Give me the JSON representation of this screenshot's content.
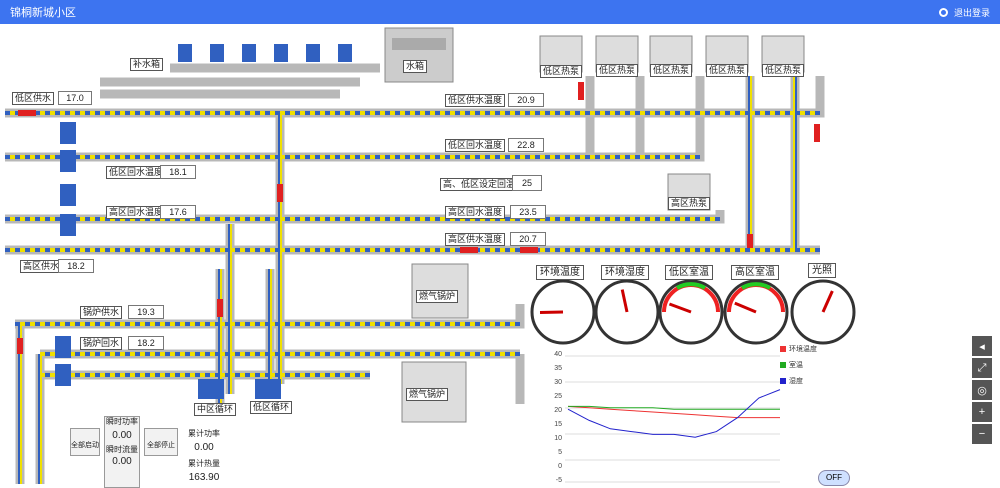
{
  "app": {
    "title": "锦桐新城小区",
    "logout_label": "退出登录"
  },
  "labels": {
    "tank": "补水箱",
    "storage": "水箱",
    "low_supply": "低区供水",
    "high_supply": "高区供水",
    "low_return_temp": "低区回水温度",
    "high_return_temp": "高区回水温度",
    "low_supply_temp": "低区供水温度",
    "low_return_label": "低区回水温度",
    "setpoint": "高、低区设定回温",
    "high_return": "高区回水温度",
    "high_supply_temp": "高区供水温度",
    "boiler_supply": "锅炉供水",
    "boiler_return": "锅炉回水",
    "mid_pump": "中区循环",
    "low_pump": "低区循环",
    "boiler1": "燃气锅炉",
    "boiler2": "燃气锅炉",
    "hp1": "低区热泵",
    "hp2": "低区热泵",
    "hp3": "低区热泵",
    "hp4": "低区热泵",
    "hp5": "低区热泵",
    "hp6": "高区热泵"
  },
  "values": {
    "low_supply": "17.0",
    "high_supply": "18.2",
    "low_return_temp": "18.1",
    "high_return_temp": "17.6",
    "low_supply_temp": "20.9",
    "low_return_label": "22.8",
    "setpoint": "25",
    "high_return": "23.5",
    "high_supply_temp": "20.7",
    "boiler_supply": "19.3",
    "boiler_return": "18.2"
  },
  "gauges": [
    {
      "title": "环境温度",
      "value": 12
    },
    {
      "title": "环境湿度",
      "value": 45
    },
    {
      "title": "低区室温",
      "value": 21
    },
    {
      "title": "高区室温",
      "value": 22
    },
    {
      "title": "光照",
      "value": 60
    }
  ],
  "controls": {
    "power_label": "瞬时功率",
    "power_value": "0.00",
    "flow_label": "瞬时流量",
    "flow_value": "0.00",
    "total_label": "累计功率",
    "total_value": "0.00",
    "acc_label": "累计热量",
    "acc_value": "163.90",
    "open_label": "全部启动",
    "stop_label": "全部停止",
    "off_label": "OFF"
  },
  "chart_data": {
    "type": "line",
    "ylim": [
      -5,
      40
    ],
    "yticks": [
      -5,
      0,
      5,
      10,
      15,
      20,
      25,
      30,
      35,
      40
    ],
    "series": [
      {
        "name": "环境温度",
        "color": "#e33",
        "values": [
          22,
          21.5,
          21,
          20.5,
          20,
          19.5,
          19,
          18.5,
          18,
          18,
          18
        ]
      },
      {
        "name": "室温",
        "color": "#2a2",
        "values": [
          22,
          22,
          21.5,
          21.5,
          21.5,
          21,
          21,
          21,
          21,
          21,
          21
        ]
      },
      {
        "name": "湿度",
        "color": "#22c",
        "values": [
          21,
          17,
          14,
          13,
          12,
          12,
          11,
          13,
          18,
          25,
          28
        ]
      }
    ]
  },
  "colors": {
    "pipe": "#b8b8b8",
    "pipe_blue": "#3060c0",
    "dash_yellow": "#f0e000",
    "accent": "#3d74f0"
  }
}
